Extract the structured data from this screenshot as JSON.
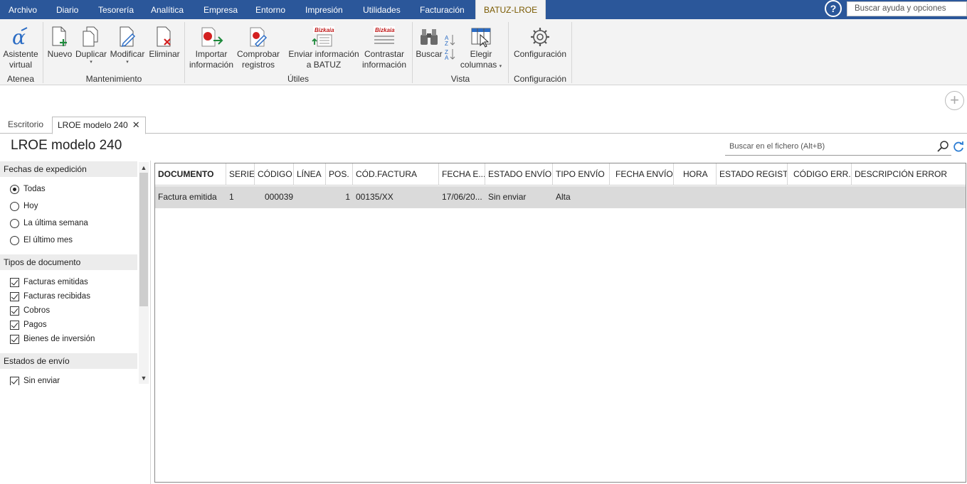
{
  "menu": {
    "tabs": [
      "Archivo",
      "Diario",
      "Tesorería",
      "Analítica",
      "Empresa",
      "Entorno",
      "Impresión",
      "Utilidades",
      "Facturación"
    ],
    "active_tab": "BATUZ-LROE",
    "help_label": "?",
    "help_search_placeholder": "Buscar ayuda y opciones"
  },
  "ribbon": {
    "atenea": {
      "label": "Asistente virtual",
      "group": "Atenea"
    },
    "mantenimiento": {
      "group": "Mantenimiento",
      "nuevo": "Nuevo",
      "duplicar": "Duplicar",
      "modificar": "Modificar",
      "eliminar": "Eliminar"
    },
    "utiles": {
      "group": "Útiles",
      "importar_1": "Importar",
      "importar_2": "información",
      "comprobar_1": "Comprobar",
      "comprobar_2": "registros",
      "enviar_1": "Enviar información",
      "enviar_2": "a BATUZ",
      "contrastar_1": "Contrastar",
      "contrastar_2": "información",
      "bizkaia_badge": "Bizkaia"
    },
    "vista": {
      "group": "Vista",
      "buscar": "Buscar",
      "elegir_1": "Elegir",
      "elegir_2": "columnas"
    },
    "configuracion": {
      "group": "Configuración",
      "label": "Configuración"
    },
    "caret": "▾",
    "add_symbol": "+"
  },
  "doc_tabs": {
    "escritorio": "Escritorio",
    "active": "LROE modelo 240",
    "close": "✕"
  },
  "page": {
    "title": "LROE modelo 240",
    "search_placeholder": "Buscar en el fichero (Alt+B)"
  },
  "filters": {
    "fechas": {
      "title": "Fechas de expedición",
      "options": [
        "Todas",
        "Hoy",
        "La última semana",
        "El último mes"
      ],
      "selected": "Todas"
    },
    "tipos": {
      "title": "Tipos de documento",
      "options": [
        "Facturas emitidas",
        "Facturas recibidas",
        "Cobros",
        "Pagos",
        "Bienes de inversión"
      ]
    },
    "estados": {
      "title": "Estados de envío",
      "options": [
        "Sin enviar"
      ]
    },
    "scroll_up": "▲",
    "scroll_down": "▼"
  },
  "grid": {
    "columns": [
      "DOCUMENTO",
      "SERIE",
      "CÓDIGO",
      "LÍNEA",
      "POS.",
      "CÓD.FACTURA",
      "FECHA E...",
      "ESTADO ENVÍO",
      "TIPO ENVÍO",
      "FECHA ENVÍO",
      "HORA",
      "ESTADO REGIST...",
      "CÓDIGO ERR...",
      "DESCRIPCIÓN ERROR"
    ],
    "rows": [
      {
        "documento": "Factura emitida",
        "serie": "1",
        "codigo": "000039",
        "linea": "",
        "pos": "1",
        "cod_factura": "00135/XX",
        "fecha": "17/06/20...",
        "estado_envio": "Sin enviar",
        "tipo_envio": "Alta",
        "fecha_envio": "",
        "hora": "",
        "estado_registro": "",
        "codigo_error": "",
        "descripcion_error": ""
      }
    ]
  },
  "colors": {
    "menubar": "#2b579a",
    "ribbon": "#f3f3f3",
    "active_tab_text": "#7a5a00",
    "selected_row": "#dadada",
    "accent_green": "#1e8a3c",
    "accent_red": "#d32020",
    "accent_blue": "#2b6cc4"
  }
}
